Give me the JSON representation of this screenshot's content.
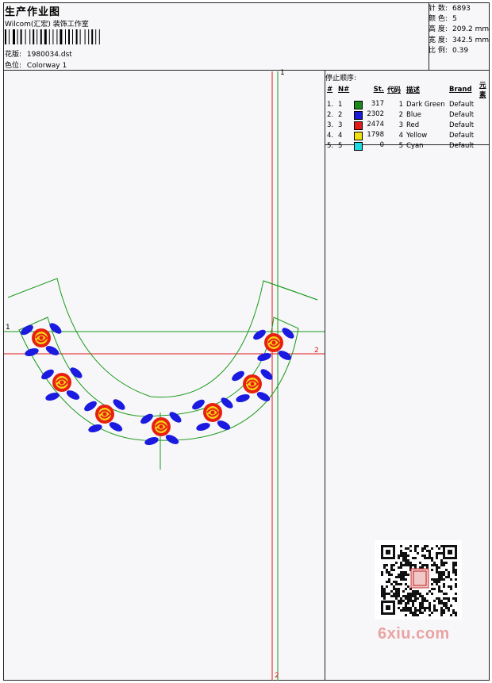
{
  "header": {
    "title": "生产作业图",
    "subtitle": "Wilcom(汇宏) 装饰工作室",
    "design_label": "花版:",
    "design_value": "1980034.dst",
    "colorway_label": "色位:",
    "colorway_value": "Colorway 1"
  },
  "stats": {
    "stitches_label": "针 数:",
    "stitches_value": "6893",
    "colors_label": "颜 色:",
    "colors_value": "5",
    "height_label": "高 度:",
    "height_value": "209.2 mm",
    "width_label": "宽 度:",
    "width_value": "342.5 mm",
    "scale_label": "比 例:",
    "scale_value": "0.39"
  },
  "stop_sequence": {
    "label": "停止顺序:",
    "columns": [
      "#",
      "N#",
      "St.",
      "代码",
      "描述",
      "Brand",
      "元素"
    ],
    "rows": [
      {
        "idx": "1.",
        "n": "1",
        "color": "#1a8a1a",
        "stitches": "317",
        "code": "1",
        "desc": "Dark Green",
        "brand": "Default"
      },
      {
        "idx": "2.",
        "n": "2",
        "color": "#1a1ad8",
        "stitches": "2302",
        "code": "2",
        "desc": "Blue",
        "brand": "Default"
      },
      {
        "idx": "3.",
        "n": "3",
        "color": "#e01a1a",
        "stitches": "2474",
        "code": "3",
        "desc": "Red",
        "brand": "Default"
      },
      {
        "idx": "4.",
        "n": "4",
        "color": "#f0e010",
        "stitches": "1798",
        "code": "4",
        "desc": "Yellow",
        "brand": "Default"
      },
      {
        "idx": "5.",
        "n": "5",
        "color": "#20d8e0",
        "stitches": "0",
        "code": "5",
        "desc": "Cyan",
        "brand": "Default"
      }
    ]
  },
  "axis_markers": {
    "v_green": "1",
    "h_green": "1",
    "h_red": "2",
    "v_red": "2"
  },
  "watermark": {
    "brand": "6xiu.com"
  },
  "colors": {
    "green_line": "#1a9a1a",
    "red_line": "#e01a1a",
    "rose_red": "#e82010",
    "rose_yellow": "#f5d21a",
    "leaf_blue": "#1a1ae0"
  }
}
